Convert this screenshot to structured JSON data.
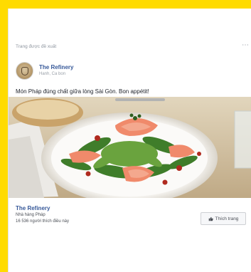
{
  "card": {
    "header_label": "Trang được đề xuất",
    "more_icon": "⋯"
  },
  "page": {
    "name": "The Refinery",
    "subtitle": "Hanh, Ca bon"
  },
  "post": {
    "message": "Món Pháp đúng chất giữa lòng Sài Gòn. Bon appétit!"
  },
  "footer": {
    "page_name": "The Refinery",
    "category": "Nhà hàng Pháp",
    "likes_text": "16 536 người thích điều này",
    "like_button_label": "Thích trang"
  },
  "colors": {
    "background": "#ffdb00",
    "link": "#365899"
  }
}
